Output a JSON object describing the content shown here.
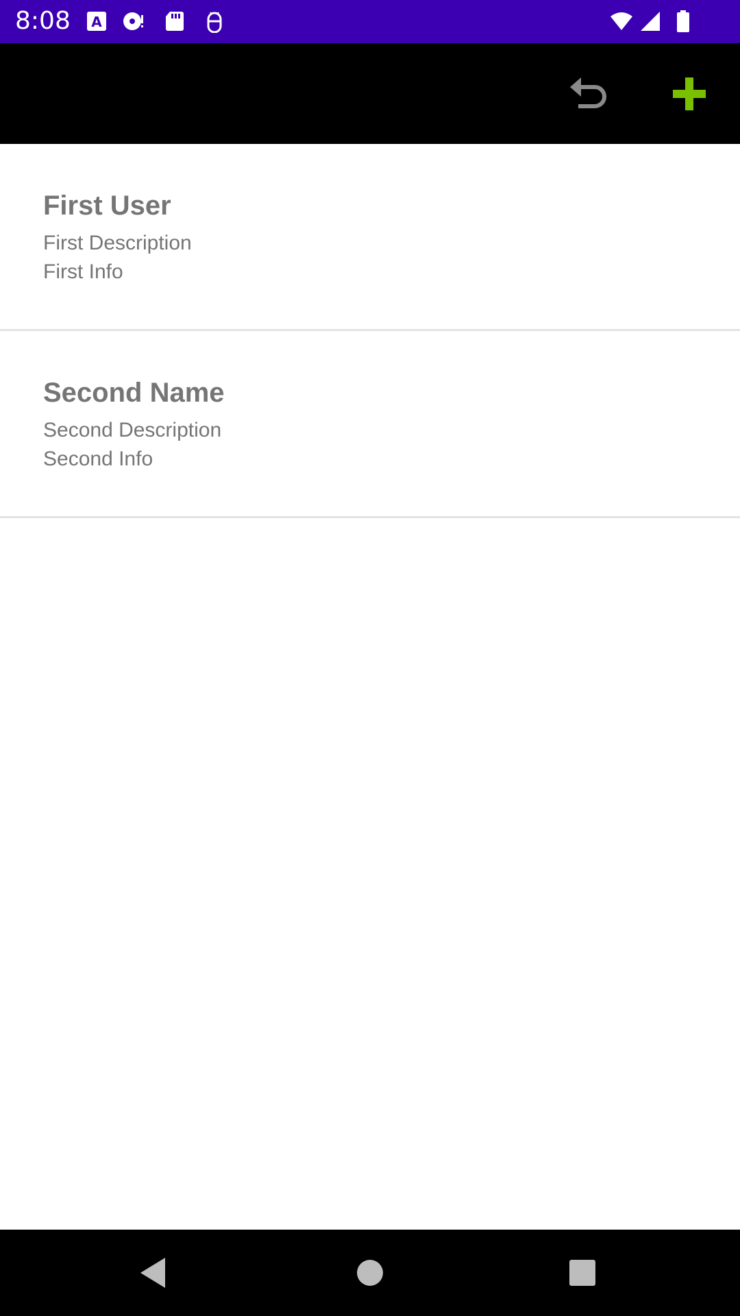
{
  "status_bar": {
    "time": "8:08",
    "background": "#3c00b2",
    "notification_icons": [
      "text-a-icon",
      "disc-icon",
      "sd-card-icon",
      "android-debug-icon"
    ],
    "system_icons": [
      "wifi-icon",
      "signal-icon",
      "battery-icon"
    ]
  },
  "toolbar": {
    "background": "#000000",
    "actions": [
      {
        "icon": "undo-icon",
        "color": "#8a8a8a"
      },
      {
        "icon": "add-icon",
        "color": "#78c000"
      }
    ]
  },
  "list": {
    "items": [
      {
        "title": "First User",
        "description": "First Description",
        "info": "First Info"
      },
      {
        "title": "Second Name",
        "description": "Second Description",
        "info": "Second Info"
      }
    ],
    "text_color": "#757575",
    "divider_color": "#e3e3e3"
  },
  "nav_bar": {
    "buttons": [
      "back-icon",
      "home-icon",
      "recents-icon"
    ],
    "icon_color": "#bdbdbd"
  }
}
